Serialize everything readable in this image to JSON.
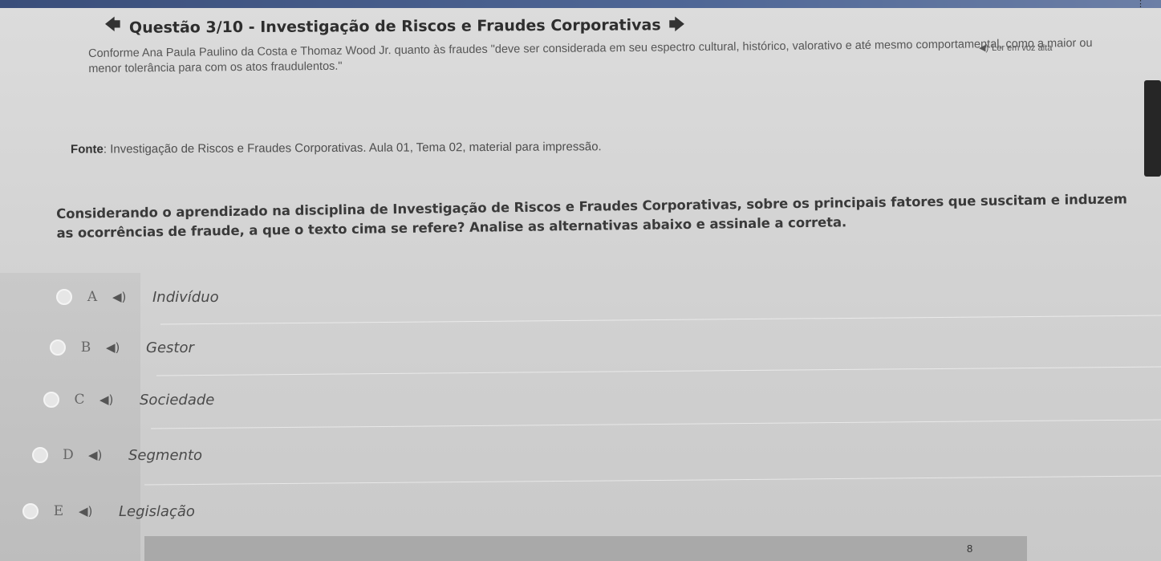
{
  "header": {
    "title": "Questão 3/10 - Investigação de Riscos e Fraudes Corporativas",
    "back_icon": "arrow-left-icon",
    "next_icon": "arrow-right-icon"
  },
  "read_aloud_label": "Ler em voz alta",
  "paragraph": "Conforme Ana Paula Paulino da Costa e Thomaz Wood Jr. quanto às fraudes \"deve ser considerada em seu espectro cultural, histórico, valorativo e até mesmo comportamental, como a maior ou menor tolerância para com os atos fraudulentos.\"",
  "source": {
    "label": "Fonte",
    "text": ": Investigação de Riscos e Fraudes Corporativas. Aula 01, Tema 02, material para impressão."
  },
  "question": "Considerando o aprendizado na disciplina de Investigação de Riscos e Fraudes Corporativas, sobre os principais fatores que suscitam e induzem as ocorrências de fraude, a que o texto cima se refere? Analise as alternativas abaixo e assinale a correta.",
  "options": [
    {
      "letter": "A",
      "text": "Indivíduo"
    },
    {
      "letter": "B",
      "text": "Gestor"
    },
    {
      "letter": "C",
      "text": "Sociedade"
    },
    {
      "letter": "D",
      "text": "Segmento"
    },
    {
      "letter": "E",
      "text": "Legislação"
    }
  ],
  "footer_number": "8"
}
